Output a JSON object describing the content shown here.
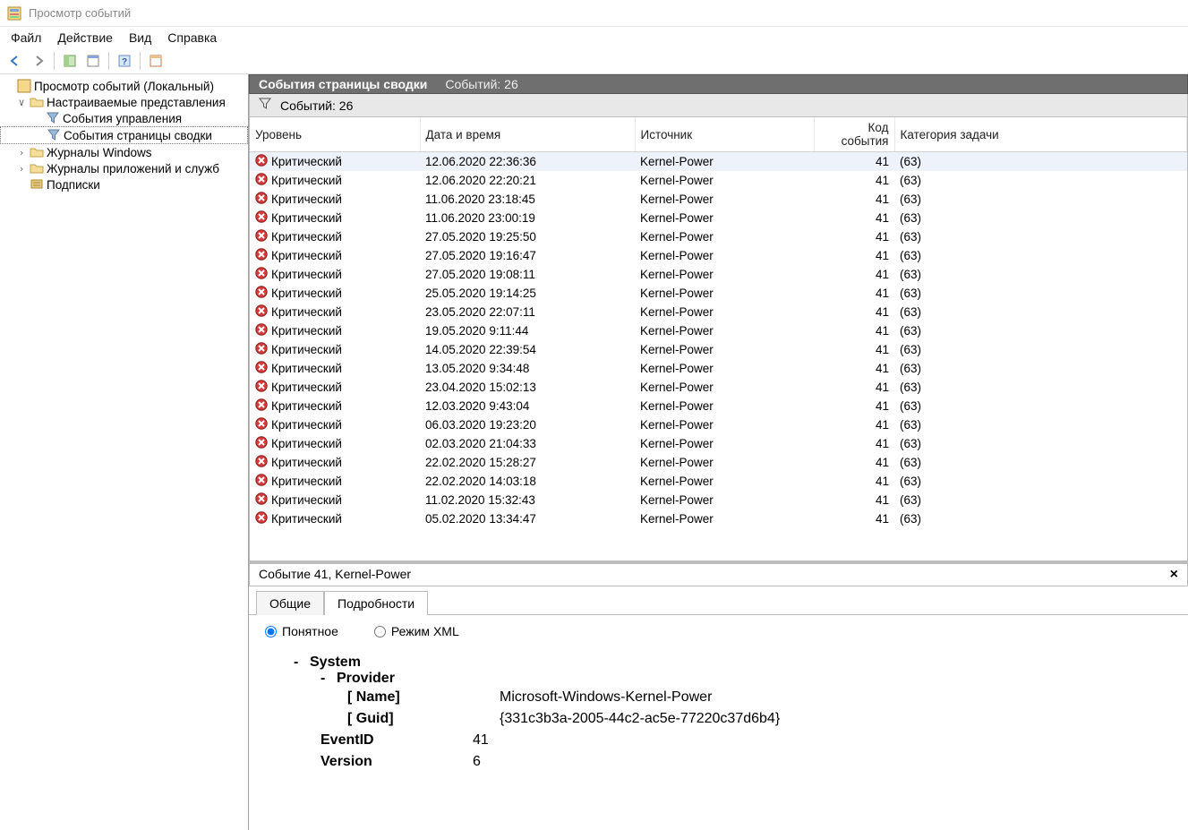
{
  "window": {
    "title": "Просмотр событий"
  },
  "menu": {
    "file": "Файл",
    "action": "Действие",
    "view": "Вид",
    "help": "Справка"
  },
  "tree": {
    "root": "Просмотр событий (Локальный)",
    "custom": "Настраиваемые представления",
    "admin": "События управления",
    "summary": "События страницы сводки",
    "winlogs": "Журналы Windows",
    "applogs": "Журналы приложений и служб",
    "subs": "Подписки"
  },
  "header": {
    "title": "События страницы сводки",
    "count": "Событий: 26"
  },
  "filter": {
    "count": "Событий: 26"
  },
  "columns": {
    "level": "Уровень",
    "datetime": "Дата и время",
    "source": "Источник",
    "eventid": "Код события",
    "category": "Категория задачи"
  },
  "events": [
    {
      "level": "Критический",
      "dt": "12.06.2020 22:36:36",
      "src": "Kernel-Power",
      "id": "41",
      "cat": "(63)",
      "selected": true
    },
    {
      "level": "Критический",
      "dt": "12.06.2020 22:20:21",
      "src": "Kernel-Power",
      "id": "41",
      "cat": "(63)"
    },
    {
      "level": "Критический",
      "dt": "11.06.2020 23:18:45",
      "src": "Kernel-Power",
      "id": "41",
      "cat": "(63)"
    },
    {
      "level": "Критический",
      "dt": "11.06.2020 23:00:19",
      "src": "Kernel-Power",
      "id": "41",
      "cat": "(63)"
    },
    {
      "level": "Критический",
      "dt": "27.05.2020 19:25:50",
      "src": "Kernel-Power",
      "id": "41",
      "cat": "(63)"
    },
    {
      "level": "Критический",
      "dt": "27.05.2020 19:16:47",
      "src": "Kernel-Power",
      "id": "41",
      "cat": "(63)"
    },
    {
      "level": "Критический",
      "dt": "27.05.2020 19:08:11",
      "src": "Kernel-Power",
      "id": "41",
      "cat": "(63)"
    },
    {
      "level": "Критический",
      "dt": "25.05.2020 19:14:25",
      "src": "Kernel-Power",
      "id": "41",
      "cat": "(63)"
    },
    {
      "level": "Критический",
      "dt": "23.05.2020 22:07:11",
      "src": "Kernel-Power",
      "id": "41",
      "cat": "(63)"
    },
    {
      "level": "Критический",
      "dt": "19.05.2020 9:11:44",
      "src": "Kernel-Power",
      "id": "41",
      "cat": "(63)"
    },
    {
      "level": "Критический",
      "dt": "14.05.2020 22:39:54",
      "src": "Kernel-Power",
      "id": "41",
      "cat": "(63)"
    },
    {
      "level": "Критический",
      "dt": "13.05.2020 9:34:48",
      "src": "Kernel-Power",
      "id": "41",
      "cat": "(63)"
    },
    {
      "level": "Критический",
      "dt": "23.04.2020 15:02:13",
      "src": "Kernel-Power",
      "id": "41",
      "cat": "(63)"
    },
    {
      "level": "Критический",
      "dt": "12.03.2020 9:43:04",
      "src": "Kernel-Power",
      "id": "41",
      "cat": "(63)"
    },
    {
      "level": "Критический",
      "dt": "06.03.2020 19:23:20",
      "src": "Kernel-Power",
      "id": "41",
      "cat": "(63)"
    },
    {
      "level": "Критический",
      "dt": "02.03.2020 21:04:33",
      "src": "Kernel-Power",
      "id": "41",
      "cat": "(63)"
    },
    {
      "level": "Критический",
      "dt": "22.02.2020 15:28:27",
      "src": "Kernel-Power",
      "id": "41",
      "cat": "(63)"
    },
    {
      "level": "Критический",
      "dt": "22.02.2020 14:03:18",
      "src": "Kernel-Power",
      "id": "41",
      "cat": "(63)"
    },
    {
      "level": "Критический",
      "dt": "11.02.2020 15:32:43",
      "src": "Kernel-Power",
      "id": "41",
      "cat": "(63)"
    },
    {
      "level": "Критический",
      "dt": "05.02.2020 13:34:47",
      "src": "Kernel-Power",
      "id": "41",
      "cat": "(63)"
    }
  ],
  "detail": {
    "title": "Событие 41, Kernel-Power",
    "tab_general": "Общие",
    "tab_details": "Подробности",
    "radio_friendly": "Понятное",
    "radio_xml": "Режим XML",
    "system_label": "System",
    "provider_label": "Provider",
    "name_key": "[ Name]",
    "name_val": "Microsoft-Windows-Kernel-Power",
    "guid_key": "[ Guid]",
    "guid_val": "{331c3b3a-2005-44c2-ac5e-77220c37d6b4}",
    "eventid_key": "EventID",
    "eventid_val": "41",
    "version_key": "Version",
    "version_val": "6"
  }
}
